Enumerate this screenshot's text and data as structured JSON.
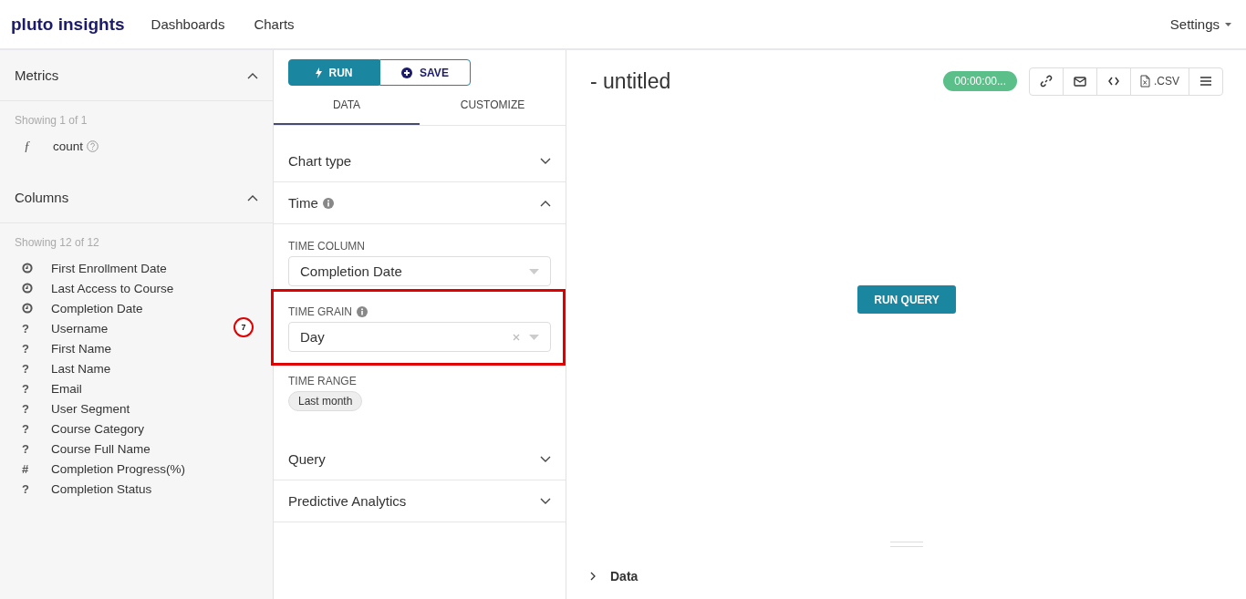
{
  "header": {
    "logo": "pluto insights",
    "nav": [
      {
        "label": "Dashboards"
      },
      {
        "label": "Charts"
      }
    ],
    "settings": "Settings"
  },
  "sidebar": {
    "sections": [
      {
        "title": "Metrics",
        "expanded": true,
        "count": "Showing 1 of 1",
        "items": [
          {
            "kind": "metric",
            "symbol": "ƒ",
            "label": "count",
            "help": true
          }
        ]
      },
      {
        "title": "Columns",
        "expanded": true,
        "count": "Showing 12 of 12",
        "items": [
          {
            "kind": "time",
            "label": "First Enrollment Date"
          },
          {
            "kind": "time",
            "label": "Last Access to Course"
          },
          {
            "kind": "time",
            "label": "Completion Date"
          },
          {
            "kind": "text",
            "symbol": "?",
            "label": "Username"
          },
          {
            "kind": "text",
            "symbol": "?",
            "label": "First Name"
          },
          {
            "kind": "text",
            "symbol": "?",
            "label": "Last Name"
          },
          {
            "kind": "text",
            "symbol": "?",
            "label": "Email"
          },
          {
            "kind": "text",
            "symbol": "?",
            "label": "User Segment"
          },
          {
            "kind": "text",
            "symbol": "?",
            "label": "Course Category"
          },
          {
            "kind": "text",
            "symbol": "?",
            "label": "Course Full Name"
          },
          {
            "kind": "number",
            "symbol": "#",
            "label": "Completion Progress(%)"
          },
          {
            "kind": "text",
            "symbol": "?",
            "label": "Completion Status"
          }
        ]
      }
    ]
  },
  "panel": {
    "buttons": [
      {
        "kind": "run",
        "label": "RUN"
      },
      {
        "kind": "save",
        "label": "SAVE"
      }
    ],
    "tabs": [
      {
        "label": "DATA",
        "selected": true
      },
      {
        "label": "CUSTOMIZE",
        "selected": false
      }
    ],
    "sections": [
      {
        "title": "Chart type",
        "expanded": false
      },
      {
        "title": "Time",
        "info": true,
        "expanded": true,
        "fields": [
          {
            "kind": "select",
            "label": "TIME COLUMN",
            "value": "Completion Date"
          },
          {
            "kind": "select",
            "label": "TIME GRAIN",
            "info": true,
            "clearable": true,
            "highlighted": true,
            "annotation": "7",
            "value": "Day"
          },
          {
            "kind": "tags",
            "label": "TIME RANGE",
            "tags": [
              "Last month"
            ]
          }
        ]
      },
      {
        "title": "Query",
        "expanded": false
      },
      {
        "title": "Predictive Analytics",
        "expanded": false
      }
    ]
  },
  "chart": {
    "title": "- untitled",
    "timer": "00:00:00...",
    "actions": [
      {
        "kind": "link"
      },
      {
        "kind": "mail"
      },
      {
        "kind": "code"
      },
      {
        "kind": "csv",
        "label": ".CSV"
      },
      {
        "kind": "menu"
      }
    ],
    "run_button": "RUN QUERY",
    "data_toggle": {
      "label": "Data",
      "expanded": false
    }
  }
}
